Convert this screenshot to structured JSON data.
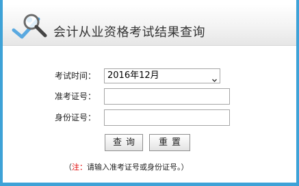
{
  "header": {
    "title": "会计从业资格考试结果查询",
    "icon": "magnifier-check-icon"
  },
  "form": {
    "exam_time_label": "考试时间：",
    "exam_time_value": "2016年12月",
    "admission_no_label": "准考证号：",
    "admission_no_value": "",
    "id_no_label": "身份证号：",
    "id_no_value": ""
  },
  "buttons": {
    "query_label": "查询",
    "reset_label": "重置"
  },
  "note": {
    "open_paren": "（",
    "prefix": "注：",
    "text": "请输入准考证号或身份证号。）"
  },
  "colors": {
    "frame_blue": "#3ea2d7",
    "note_red": "#e10000"
  }
}
